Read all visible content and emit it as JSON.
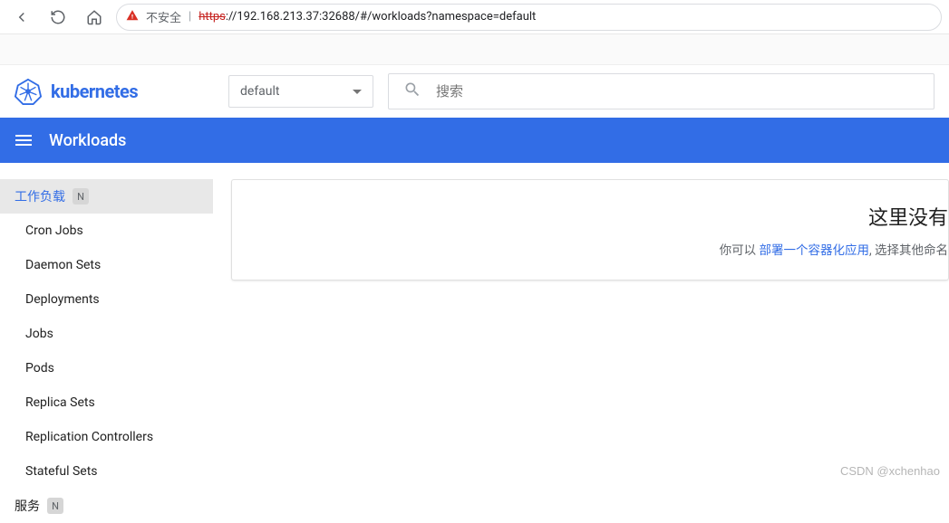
{
  "browser": {
    "insecure_text": "不安全",
    "url_protocol": "https",
    "url_rest": "://192.168.213.37:32688/#/workloads?namespace=default"
  },
  "header": {
    "brand": "kubernetes",
    "namespace_selected": "default",
    "search_placeholder": "搜索"
  },
  "toolbar": {
    "title": "Workloads"
  },
  "sidebar": {
    "workloads_label": "工作负载",
    "workloads_badge": "N",
    "items": [
      "Cron Jobs",
      "Daemon Sets",
      "Deployments",
      "Jobs",
      "Pods",
      "Replica Sets",
      "Replication Controllers",
      "Stateful Sets"
    ],
    "services_label": "服务",
    "services_badge": "N"
  },
  "main": {
    "empty_title": "这里没有",
    "empty_prefix": "你可以 ",
    "empty_link": "部署一个容器化应用",
    "empty_suffix": ", 选择其他命名"
  },
  "watermark": "CSDN @xchenhao"
}
